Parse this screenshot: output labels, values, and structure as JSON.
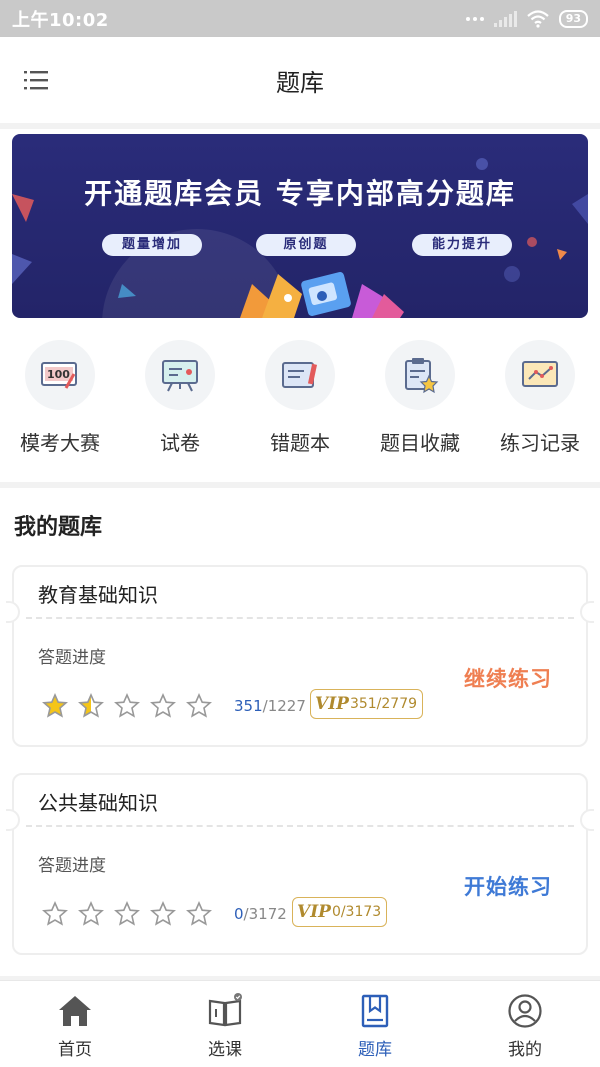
{
  "status_bar": {
    "time": "上午10:02",
    "battery": "93"
  },
  "header": {
    "title": "题库"
  },
  "banner": {
    "title": "开通题库会员 专享内部高分题库",
    "tags": [
      "题量增加",
      "原创题",
      "能力提升"
    ]
  },
  "quick_actions": [
    {
      "label": "模考大赛",
      "icon": "score-100-icon"
    },
    {
      "label": "试卷",
      "icon": "easel-board-icon"
    },
    {
      "label": "错题本",
      "icon": "notebook-pen-icon"
    },
    {
      "label": "题目收藏",
      "icon": "clipboard-star-icon"
    },
    {
      "label": "练习记录",
      "icon": "line-chart-icon"
    }
  ],
  "section_title": "我的题库",
  "cards": [
    {
      "title": "教育基础知识",
      "progress_label": "答题进度",
      "rating": 1.5,
      "done": "351",
      "total": "/1227",
      "vip_mark": "VIP",
      "vip_progress": "351/2779",
      "action": "继续练习"
    },
    {
      "title": "公共基础知识",
      "progress_label": "答题进度",
      "rating": 0,
      "done": "0",
      "total": "/3172",
      "vip_mark": "VIP",
      "vip_progress": "0/3173",
      "action": "开始练习"
    }
  ],
  "bottom_nav": [
    {
      "label": "首页",
      "icon": "home-icon",
      "active": false
    },
    {
      "label": "选课",
      "icon": "open-book-icon",
      "active": false
    },
    {
      "label": "题库",
      "icon": "bookmark-book-icon",
      "active": true
    },
    {
      "label": "我的",
      "icon": "user-circle-icon",
      "active": false
    }
  ],
  "colors": {
    "accent_blue": "#2d5fb8",
    "action_orange": "#ef7f52",
    "action_blue": "#3f7ad6",
    "vip_gold": "#d9b35a",
    "banner_bg": "#2a2c7a"
  }
}
